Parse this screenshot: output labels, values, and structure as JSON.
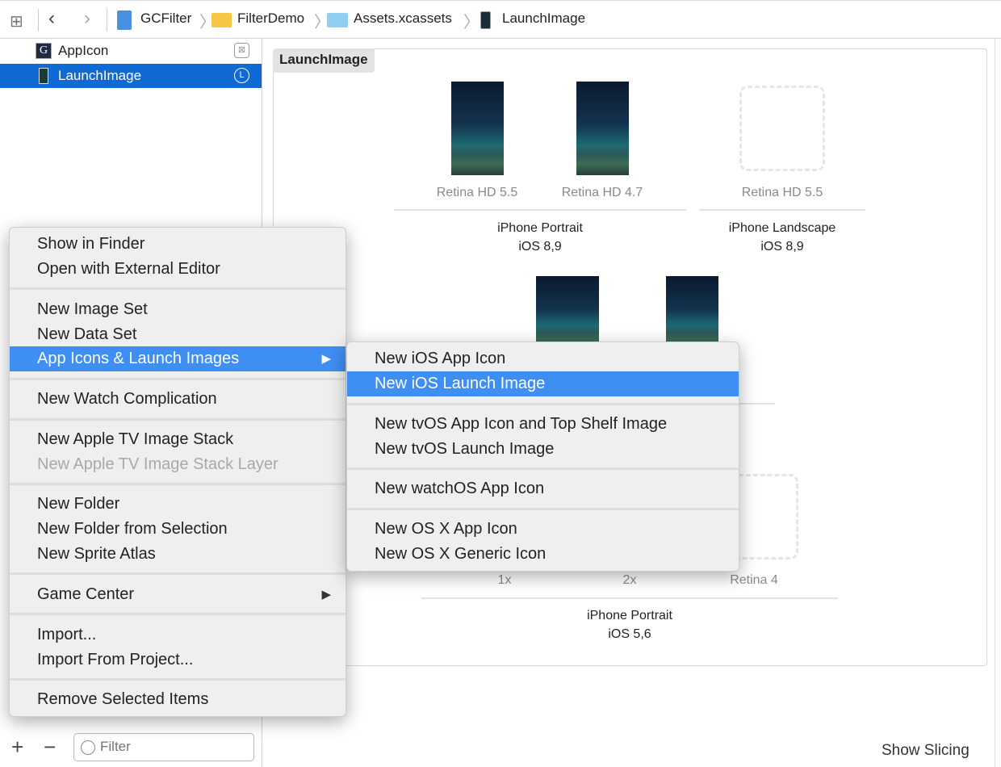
{
  "toolbar": {
    "breadcrumb": [
      "GCFilter",
      "FilterDemo",
      "Assets.xcassets",
      "LaunchImage"
    ]
  },
  "sidebar": {
    "items": [
      {
        "label": "AppIcon",
        "badge": "",
        "selected": false
      },
      {
        "label": "LaunchImage",
        "badge": "L",
        "selected": true
      }
    ],
    "filter_placeholder": "Filter",
    "add": "+",
    "remove": "−"
  },
  "editor": {
    "title": "LaunchImage",
    "row1": {
      "captions": [
        "Retina HD 5.5",
        "Retina HD 4.7",
        "Retina HD 5.5"
      ],
      "groups": [
        {
          "line1": "iPhone Portrait",
          "line2": "iOS 8,9"
        },
        {
          "line1": "iPhone Landscape",
          "line2": "iOS 8,9"
        }
      ]
    },
    "row3": {
      "captions": [
        "1x",
        "2x",
        "Retina 4"
      ],
      "group": {
        "line1": "iPhone Portrait",
        "line2": "iOS 5,6"
      }
    },
    "show_slicing": "Show Slicing"
  },
  "context_menu": {
    "items": [
      "Show in Finder",
      "Open with External Editor",
      "New Image Set",
      "New Data Set",
      "App Icons & Launch Images",
      "New Watch Complication",
      "New Apple TV Image Stack",
      "New Apple TV Image Stack Layer",
      "New Folder",
      "New Folder from Selection",
      "New Sprite Atlas",
      "Game Center",
      "Import...",
      "Import From Project...",
      "Remove Selected Items"
    ],
    "arrow": "▶"
  },
  "submenu": {
    "items": [
      "New iOS App Icon",
      "New iOS Launch Image",
      "New tvOS App Icon and Top Shelf Image",
      "New tvOS Launch Image",
      "New watchOS App Icon",
      "New OS X App Icon",
      "New OS X Generic Icon"
    ]
  },
  "colors": {
    "selection": "#0f6ad6",
    "menu_highlight": "#3f8ef2"
  }
}
